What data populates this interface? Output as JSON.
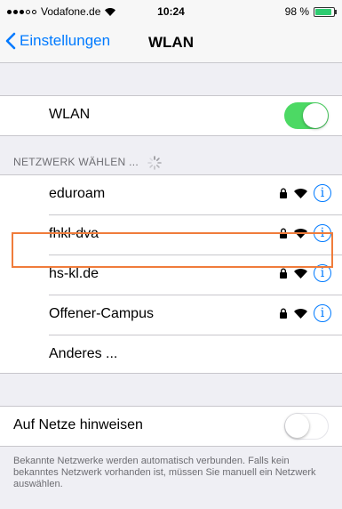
{
  "status_bar": {
    "carrier": "Vodafone.de",
    "time": "10:24",
    "battery": "98 %",
    "battery_level": 0.98
  },
  "nav": {
    "back_label": "Einstellungen",
    "title": "WLAN"
  },
  "wlan_toggle": {
    "label": "WLAN",
    "on": true
  },
  "section_header": "NETZWERK WÄHLEN ...",
  "networks": [
    {
      "name": "eduroam",
      "locked": true,
      "info": "i"
    },
    {
      "name": "fhkl-dva",
      "locked": true,
      "info": "i"
    },
    {
      "name": "hs-kl.de",
      "locked": true,
      "info": "i"
    },
    {
      "name": "Offener-Campus",
      "locked": true,
      "info": "i"
    }
  ],
  "other_network": "Anderes ...",
  "ask_to_join": {
    "label": "Auf Netze hinweisen",
    "on": false
  },
  "footer": "Bekannte Netzwerke werden automatisch verbunden. Falls kein bekanntes Netzwerk vorhanden ist, müssen Sie manuell ein Netzwerk auswählen.",
  "colors": {
    "accent": "#007aff",
    "toggle_on": "#4cd964",
    "highlight": "#f07c3b"
  }
}
